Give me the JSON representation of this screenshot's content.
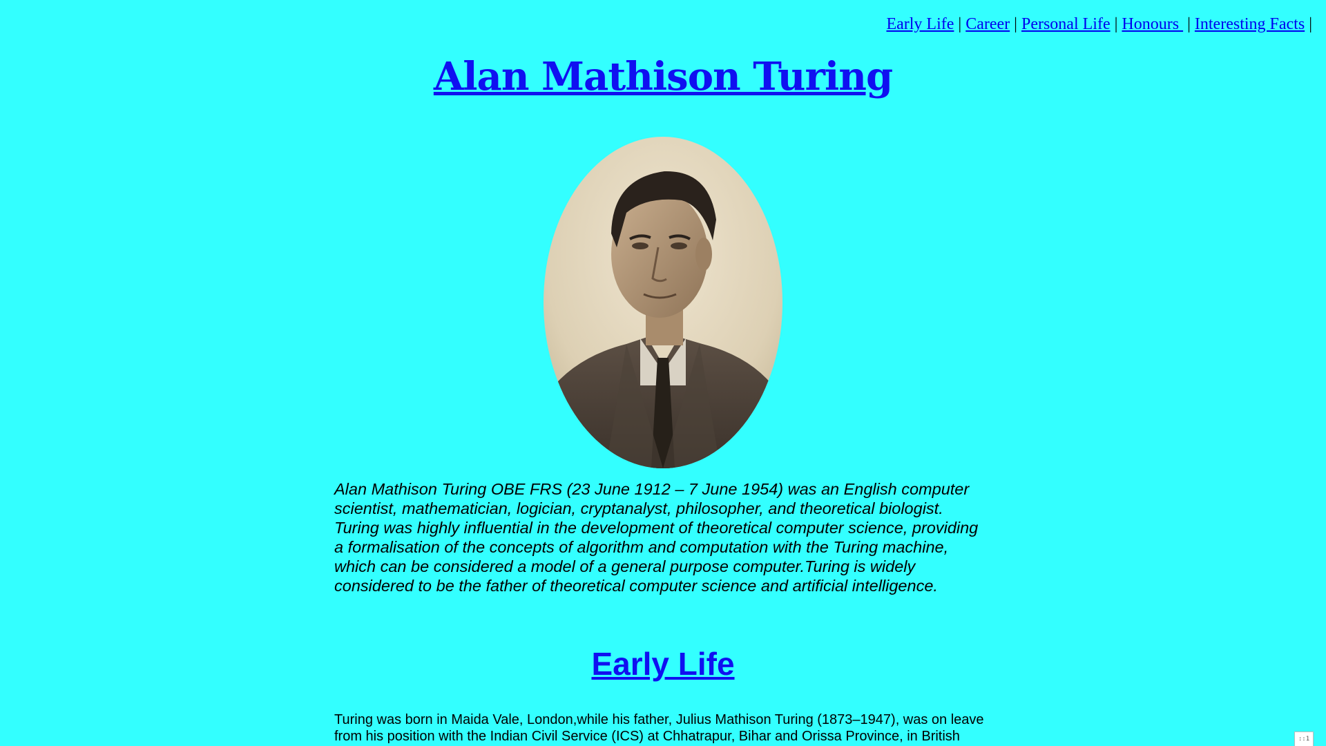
{
  "nav": {
    "items": [
      {
        "label": "Early Life"
      },
      {
        "label": "Career"
      },
      {
        "label": "Personal Life"
      },
      {
        "label": "Honours "
      },
      {
        "label": "Interesting Facts"
      }
    ],
    "separator": "|"
  },
  "page_title": "Alan Mathison Turing",
  "intro": "Alan Mathison Turing OBE FRS (23 June 1912 – 7 June 1954) was an English computer scientist, mathematician, logician, cryptanalyst, philosopher, and theoretical biologist. Turing was highly influential in the development of theoretical computer science, providing a formalisation of the concepts of algorithm and computation with the Turing machine, which can be considered a model of a general purpose computer.Turing is widely considered to be the father of theoretical computer science and artificial intelligence.",
  "sections": [
    {
      "heading": "Early Life",
      "text": "Turing was born in Maida Vale, London,while his father, Julius Mathison Turing (1873–1947), was on leave from his position with the Indian Civil Service (ICS) at Chhatrapur, Bihar and Orissa Province, in British"
    }
  ],
  "corner_badge": "::1",
  "colors": {
    "background": "#33ffff",
    "link": "#0000ee",
    "heading_link": "#1010f0"
  }
}
